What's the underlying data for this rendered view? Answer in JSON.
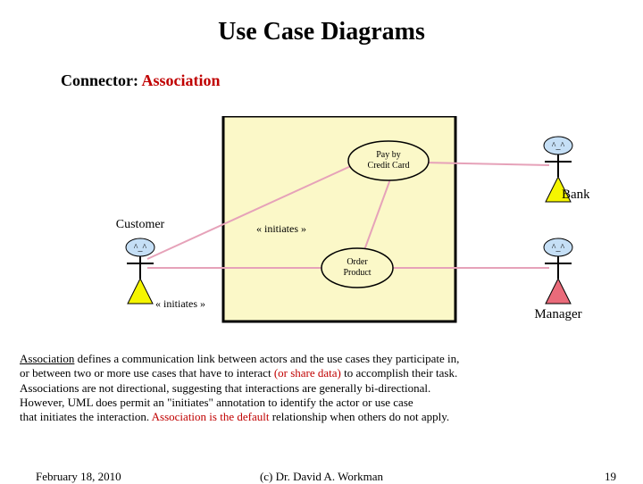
{
  "slide": {
    "title": "Use Case Diagrams",
    "subtitle_prefix": "Connector:",
    "subtitle_keyword": "Association"
  },
  "diagram": {
    "actors": [
      {
        "id": "customer",
        "label": "Customer"
      },
      {
        "id": "bank",
        "label": "Bank"
      },
      {
        "id": "manager",
        "label": "Manager"
      }
    ],
    "usecases": [
      {
        "id": "pay",
        "label_line1": "Pay by",
        "label_line2": "Credit Card"
      },
      {
        "id": "order",
        "label_line1": "Order",
        "label_line2": "Product"
      }
    ],
    "stereotypes": {
      "initiates": "« initiates »"
    }
  },
  "text": {
    "association_word": "Association",
    "l1_tail": " defines a communication link between actors and the use cases they participate in,",
    "l2_head": "or between two or more use cases that have to interact ",
    "l2_red": "(or share data)",
    "l2_tail": " to accomplish their task.",
    "l3": "Associations are not directional, suggesting that interactions are generally bi-directional.",
    "l4": "However, UML does permit an \"initiates\" annotation to identify the actor or use case",
    "l5_head": "that initiates the interaction.   ",
    "l5_red": "Association is the default",
    "l5_tail": " relationship when others do not apply."
  },
  "footer": {
    "date": "February 18, 2010",
    "copyright": "(c) Dr. David A. Workman",
    "page": "19"
  }
}
